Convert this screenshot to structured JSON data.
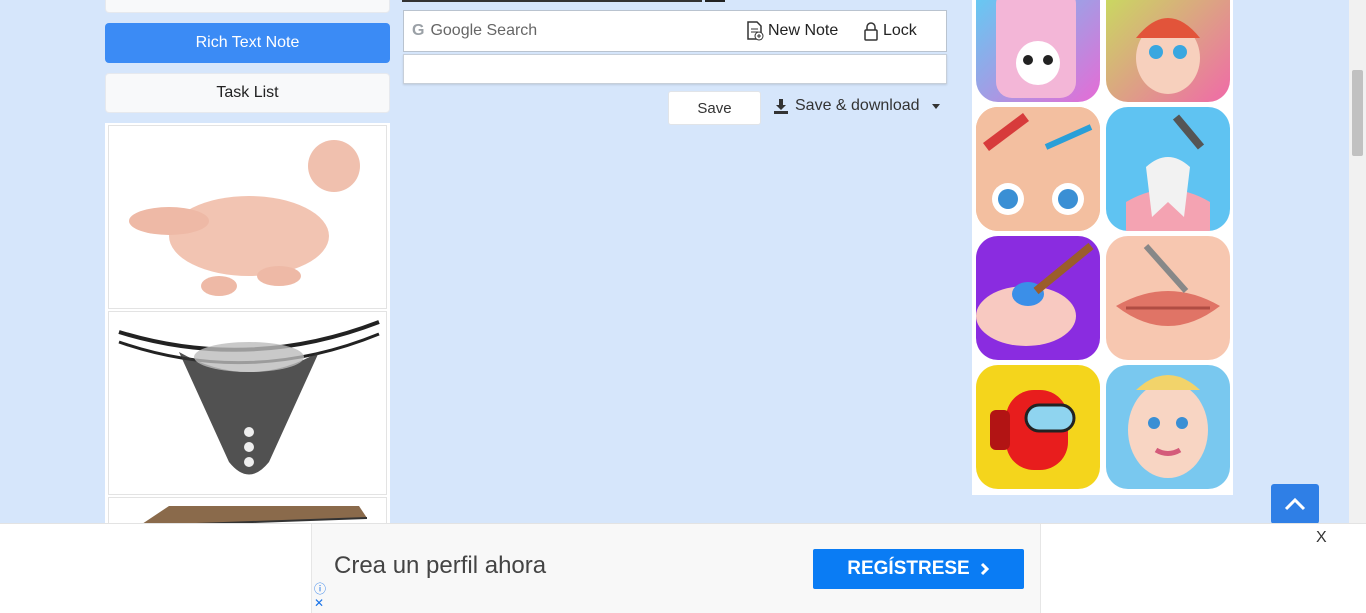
{
  "sidebar": {
    "rich_text_label": "Rich Text Note",
    "task_list_label": "Task List"
  },
  "toolbar": {
    "search_placeholder": "Google Search",
    "new_note_label": "New Note",
    "lock_label": "Lock"
  },
  "actions": {
    "save_label": "Save",
    "save_download_label": "Save & download"
  },
  "ads": {
    "ad_info_icon": "info-icon",
    "ad_close_icon": "close-icon",
    "bottom_banner": {
      "text": "Crea un perfil ahora",
      "cta_label": "REGÍSTRESE",
      "close_label": "X"
    }
  },
  "colors": {
    "page_bg": "#d6e6fb",
    "primary": "#3b8bf5",
    "cta": "#0a7cf4"
  }
}
